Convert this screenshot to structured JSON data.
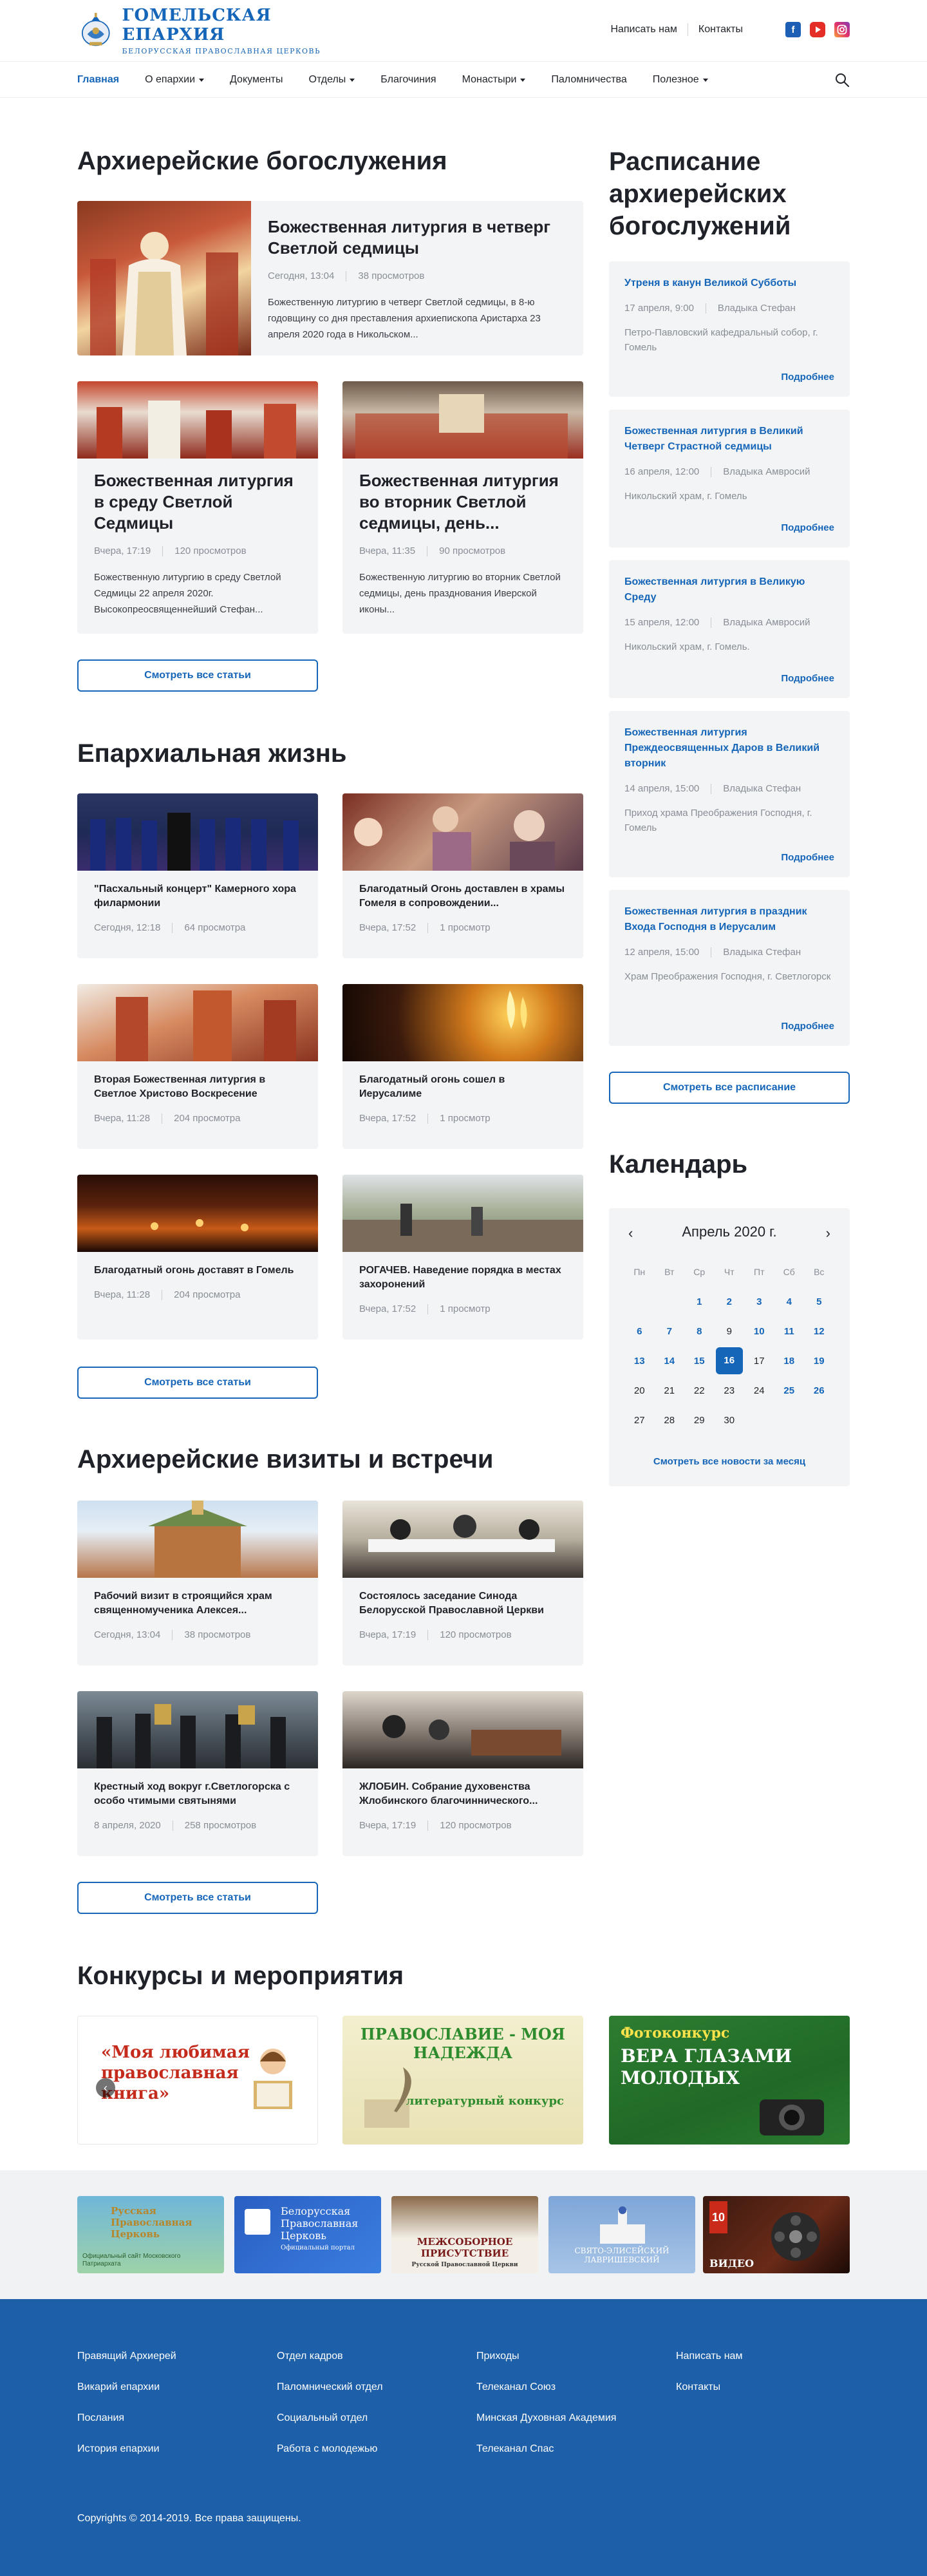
{
  "header": {
    "logo_title": "ГОМЕЛЬСКАЯ ЕПАРХИЯ",
    "logo_subtitle": "БЕЛОРУССКАЯ ПРАВОСЛАВНАЯ ЦЕРКОВЬ",
    "links": [
      "Написать нам",
      "Контакты"
    ],
    "socials": [
      "facebook-icon",
      "youtube-icon",
      "instagram-icon"
    ]
  },
  "nav": {
    "items": [
      {
        "label": "Главная",
        "dropdown": false
      },
      {
        "label": "О епархии",
        "dropdown": true
      },
      {
        "label": "Документы",
        "dropdown": false
      },
      {
        "label": "Отделы",
        "dropdown": true
      },
      {
        "label": "Благочиния",
        "dropdown": false
      },
      {
        "label": "Монастыри",
        "dropdown": true
      },
      {
        "label": "Паломничества",
        "dropdown": false
      },
      {
        "label": "Полезное",
        "dropdown": true
      }
    ]
  },
  "bishop_services": {
    "title": "Архиерейские богослужения",
    "featured": {
      "title": "Божественная литургия в четверг Светлой седмицы",
      "date": "Сегодня, 13:04",
      "views": "38 просмотров",
      "excerpt": "Божественную литургию в четверг Светлой седмицы, в 8-ю годовщину со дня преставления архиепископа Аристарха 23 апреля 2020 года в Никольском..."
    },
    "cards": [
      {
        "title": "Божественная литургия в среду Светлой Седмицы",
        "date": "Вчера, 17:19",
        "views": "120 просмотров",
        "excerpt": "Божественную литургию в среду Светлой Седмицы 22 апреля 2020г. Высокопреосвященнейший Стефан..."
      },
      {
        "title": "Божественная литургия во вторник Светлой седмицы, день...",
        "date": "Вчера, 11:35",
        "views": "90 просмотров",
        "excerpt": "Божественную литургию во вторник Светлой седмицы, день празднования Иверской иконы..."
      }
    ],
    "button": "Смотреть все статьи"
  },
  "schedule": {
    "title": "Расписание архиерейских богослужений",
    "items": [
      {
        "title": "Утреня в канун Великой Субботы",
        "date": "17 апреля, 9:00",
        "bishop": "Владыка Стефан",
        "place": "Петро-Павловский кафедральный собор, г. Гомель",
        "more": "Подробнее"
      },
      {
        "title": "Божественная литургия в Великий Четверг Страстной седмицы",
        "date": "16 апреля, 12:00",
        "bishop": "Владыка Амвросий",
        "place": "Никольский храм, г. Гомель",
        "more": "Подробнее"
      },
      {
        "title": "Божественная литургия в Великую Среду",
        "date": "15 апреля, 12:00",
        "bishop": "Владыка Амвросий",
        "place": "Никольский храм, г. Гомель.",
        "more": "Подробнее"
      },
      {
        "title": "Божественная литургия Преждеосвященных Даров в Великий вторник",
        "date": "14 апреля, 15:00",
        "bishop": "Владыка Стефан",
        "place": "Приход храма Преображения Господня, г. Гомель",
        "more": "Подробнее"
      },
      {
        "title": "Божественная литургия в праздник Входа Господня в Иерусалим",
        "date": "12 апреля, 15:00",
        "bishop": "Владыка Стефан",
        "place": "Храм Преображения Господня, г. Светлогорск",
        "more": "Подробнее"
      }
    ],
    "button": "Смотреть все расписание"
  },
  "diocese_life": {
    "title": "Епархиальная жизнь",
    "cards": [
      {
        "title": "\"Пасхальный концерт\" Камерного хора филармонии",
        "date": "Сегодня, 12:18",
        "views": "64 просмотра"
      },
      {
        "title": "Благодатный Огонь доставлен в храмы Гомеля в сопровождении...",
        "date": "Вчера, 17:52",
        "views": "1 просмотр"
      },
      {
        "title": "Вторая Божественная литургия в Светлое Христово Воскресение",
        "date": "Вчера, 11:28",
        "views": "204 просмотра"
      },
      {
        "title": "Благодатный огонь сошел в Иерусалиме",
        "date": "Вчера, 17:52",
        "views": "1 просмотр"
      },
      {
        "title": "Благодатный огонь доставят в Гомель",
        "date": "Вчера, 11:28",
        "views": "204 просмотра"
      },
      {
        "title": "РОГАЧЕВ. Наведение порядка в местах захоронений",
        "date": "Вчера, 17:52",
        "views": "1 просмотр"
      }
    ],
    "button": "Смотреть все статьи"
  },
  "calendar": {
    "title": "Календарь",
    "month": "Апрель 2020 г.",
    "weekdays": [
      "Пн",
      "Вт",
      "Ср",
      "Чт",
      "Пт",
      "Сб",
      "Вс"
    ],
    "weeks": [
      [
        "",
        "",
        "1",
        "2",
        "3",
        "4",
        "5"
      ],
      [
        "6",
        "7",
        "8",
        "9",
        "10",
        "11",
        "12"
      ],
      [
        "13",
        "14",
        "15",
        "16",
        "17",
        "18",
        "19"
      ],
      [
        "20",
        "21",
        "22",
        "23",
        "24",
        "25",
        "26"
      ],
      [
        "27",
        "28",
        "29",
        "30",
        "",
        "",
        ""
      ]
    ],
    "linked_days": [
      "1",
      "2",
      "3",
      "4",
      "5",
      "6",
      "7",
      "8",
      "10",
      "11",
      "12",
      "13",
      "14",
      "15",
      "18",
      "19",
      "25",
      "26"
    ],
    "today": "16",
    "footer": "Смотреть все новости за месяц"
  },
  "visits": {
    "title": "Архиерейские визиты и встречи",
    "cards": [
      {
        "title": "Рабочий визит в строящийся храм священномученика Алексея...",
        "date": "Сегодня, 13:04",
        "views": "38 просмотров"
      },
      {
        "title": "Состоялось заседание Синода Белорусской Православной Церкви",
        "date": "Вчера, 17:19",
        "views": "120 просмотров"
      },
      {
        "title": "Крестный ход вокруг г.Светлогорска с особо чтимыми святынями",
        "date": "8 апреля, 2020",
        "views": "258 просмотров"
      },
      {
        "title": "ЖЛОБИН. Собрание духовенства Жлобинского благочиннического...",
        "date": "Вчера, 17:19",
        "views": "120 просмотров"
      }
    ],
    "button": "Смотреть все статьи"
  },
  "contests": {
    "title": "Конкурсы и мероприятия",
    "banners": [
      {
        "lines": [
          "«Моя любимая",
          "православная",
          "книга»"
        ]
      },
      {
        "lines": [
          "ПРАВОСЛАВИЕ - МОЯ НАДЕЖДА",
          "литературный конкурс"
        ]
      },
      {
        "lines": [
          "Фотоконкурс",
          "ВЕРА ГЛАЗАМИ",
          "МОЛОДЫХ"
        ]
      }
    ]
  },
  "partners": [
    {
      "lines": [
        "Русская",
        "Православная",
        "Церковь",
        "Официальный сайт Московского Патриархата"
      ]
    },
    {
      "lines": [
        "Белорусская",
        "Православная",
        "Церковь",
        "Официальный портал"
      ]
    },
    {
      "lines": [
        "МЕЖСОБОРНОЕ",
        "ПРИСУТСТВИЕ",
        "Русской Православной Церкви"
      ]
    },
    {
      "lines": [
        "СВЯТО-ЭЛИСЕЙСКИЙ",
        "ЛАВРИШЕВСКИЙ"
      ]
    },
    {
      "lines": [
        "10",
        "ВИДЕО"
      ]
    }
  ],
  "footer": {
    "columns": [
      [
        "Правящий Архиерей",
        "Викарий епархии",
        "Послания",
        "История епархии"
      ],
      [
        "Отдел кадров",
        "Паломнический отдел",
        "Социальный отдел",
        "Работа с молодежью"
      ],
      [
        "Приходы",
        "Телеканал Союз",
        "Минская Духовная Академия",
        "Телеканал Спас"
      ],
      [
        "Написать нам",
        "Контакты"
      ]
    ],
    "copyright": "Copyrights © 2014-2019. Все права защищены."
  },
  "colors": {
    "accent": "#1565b8",
    "footer_bg": "#1d5fa8",
    "card_bg": "#f3f4f6",
    "muted_text": "#888e96"
  }
}
